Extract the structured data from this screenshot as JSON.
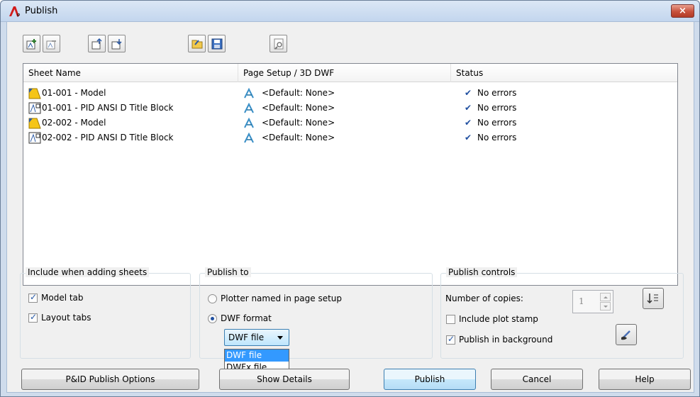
{
  "window": {
    "title": "Publish",
    "close_label": "×"
  },
  "toolbar": {
    "buttons": [
      "add-sheets",
      "remove-sheets",
      "move-sheet-up",
      "move-sheet-down",
      "load-sheet-list",
      "save-sheet-list",
      "preview"
    ]
  },
  "sheet_list": {
    "columns": [
      "Sheet Name",
      "Page Setup / 3D DWF",
      "Status"
    ],
    "rows": [
      {
        "name": "01-001 - Model",
        "type": "model",
        "page_setup": "<Default: None>",
        "status": "No errors"
      },
      {
        "name": "01-001 - PID ANSI D Title Block",
        "type": "layout",
        "page_setup": "<Default: None>",
        "status": "No errors"
      },
      {
        "name": "02-002 - Model",
        "type": "model",
        "page_setup": "<Default: None>",
        "status": "No errors"
      },
      {
        "name": "02-002 - PID ANSI D Title Block",
        "type": "layout",
        "page_setup": "<Default: None>",
        "status": "No errors"
      }
    ]
  },
  "include_group": {
    "title": "Include when adding sheets",
    "model_tab": {
      "label": "Model tab",
      "checked": true
    },
    "layout_tabs": {
      "label": "Layout tabs",
      "checked": true
    }
  },
  "publish_to_group": {
    "title": "Publish to",
    "plotter": {
      "label": "Plotter named in page setup",
      "selected": false
    },
    "dwf": {
      "label": "DWF format",
      "selected": true
    },
    "format_combo": {
      "value": "DWF file",
      "options": [
        "DWF file",
        "DWFx file"
      ],
      "highlighted": "DWF file"
    }
  },
  "publish_controls": {
    "title": "Publish controls",
    "copies_label": "Number of copies:",
    "copies_value": "1",
    "plot_stamp": {
      "label": "Include plot stamp",
      "checked": false
    },
    "background": {
      "label": "Publish in background",
      "checked": true
    }
  },
  "buttons": {
    "options": "P&ID Publish Options",
    "details": "Show Details",
    "publish": "Publish",
    "cancel": "Cancel",
    "help": "Help"
  },
  "colors": {
    "accent": "#3399ff",
    "check": "#2a5caa",
    "titlebar": "#c3d6ee",
    "close": "#c7513c"
  }
}
